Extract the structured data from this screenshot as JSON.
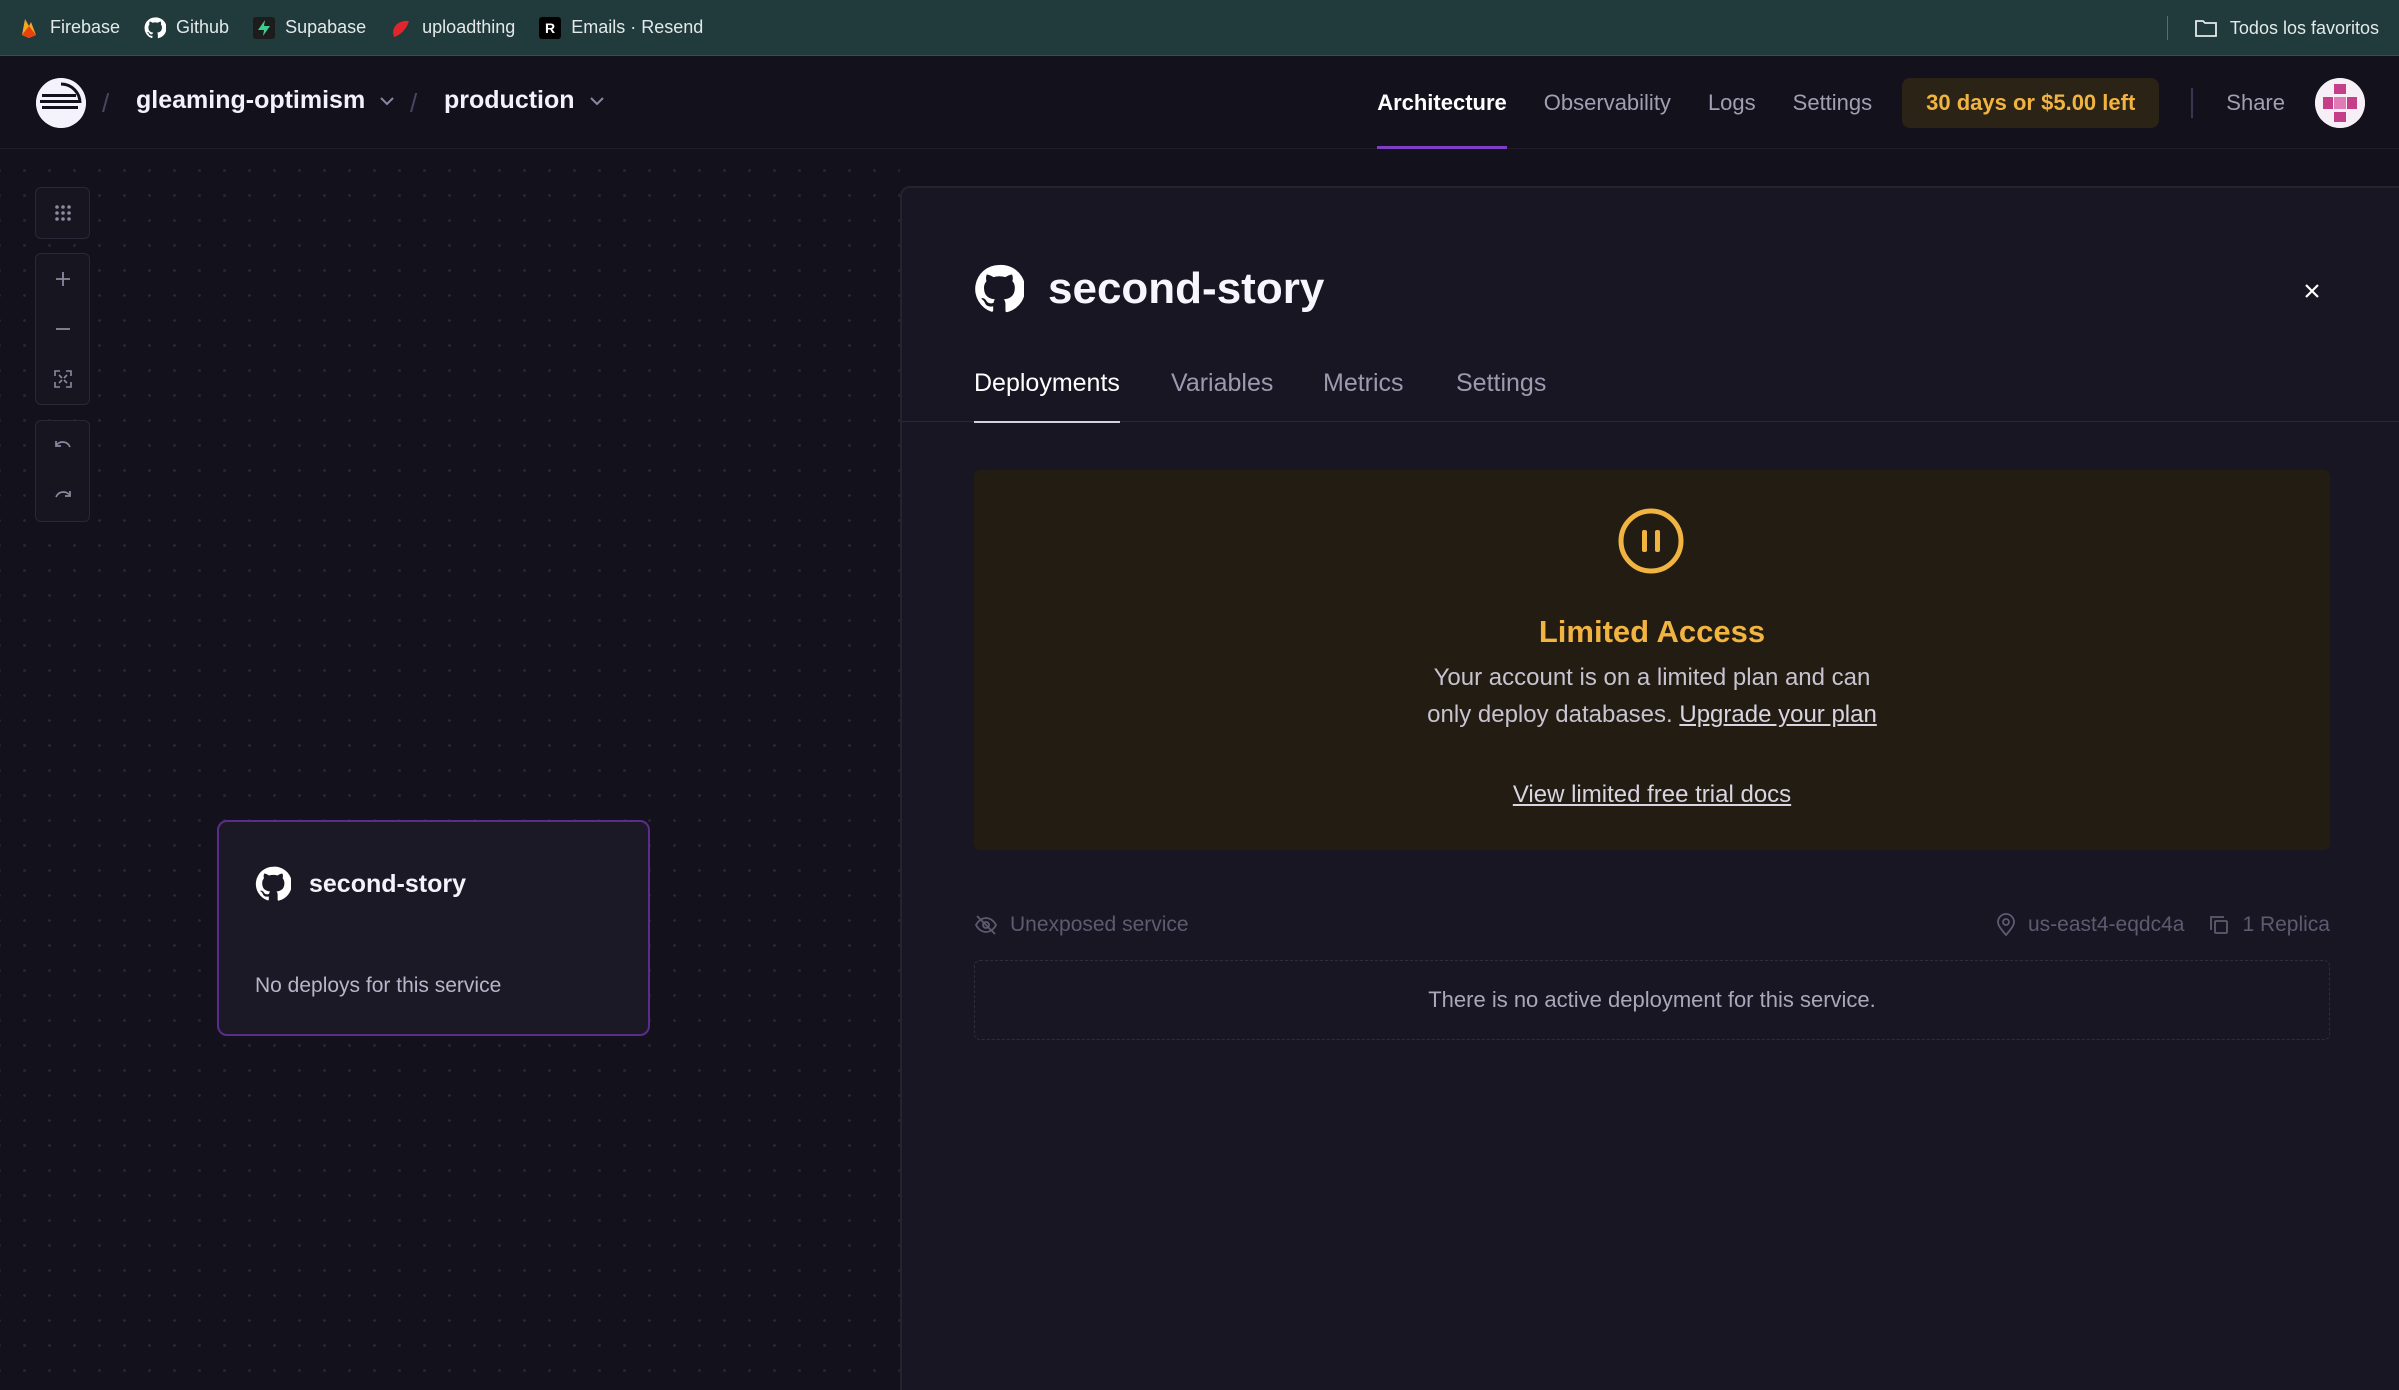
{
  "bookmarks": {
    "items": [
      {
        "label": "Firebase",
        "icon": "firebase-icon"
      },
      {
        "label": "Github",
        "icon": "github-icon"
      },
      {
        "label": "Supabase",
        "icon": "supabase-icon"
      },
      {
        "label": "uploadthing",
        "icon": "uploadthing-icon"
      },
      {
        "label": "Emails · Resend",
        "icon": "resend-icon"
      }
    ],
    "all_bookmarks_label": "Todos los favoritos"
  },
  "header": {
    "project": "gleaming-optimism",
    "environment": "production",
    "nav": [
      "Architecture",
      "Observability",
      "Logs",
      "Settings"
    ],
    "active_nav": "Architecture",
    "trial_badge": "30 days or $5.00 left",
    "share_label": "Share"
  },
  "canvas": {
    "service_card": {
      "name": "second-story",
      "status": "No deploys for this service"
    }
  },
  "panel": {
    "title": "second-story",
    "tabs": [
      "Deployments",
      "Variables",
      "Metrics",
      "Settings"
    ],
    "active_tab": "Deployments",
    "limited": {
      "heading": "Limited Access",
      "line1": "Your account is on a limited plan and can",
      "line2": "only deploy databases.",
      "upgrade_link": "Upgrade your plan",
      "docs_link": "View limited free trial docs"
    },
    "meta": {
      "exposure": "Unexposed service",
      "region": "us-east4-eqdc4a",
      "replicas": "1 Replica"
    },
    "empty_message": "There is no active deployment for this service."
  },
  "colors": {
    "accent_purple": "#7f3fc4",
    "warning_amber": "#f2b441",
    "bookmarks_bg": "#213a3b",
    "page_bg": "#13111c"
  }
}
